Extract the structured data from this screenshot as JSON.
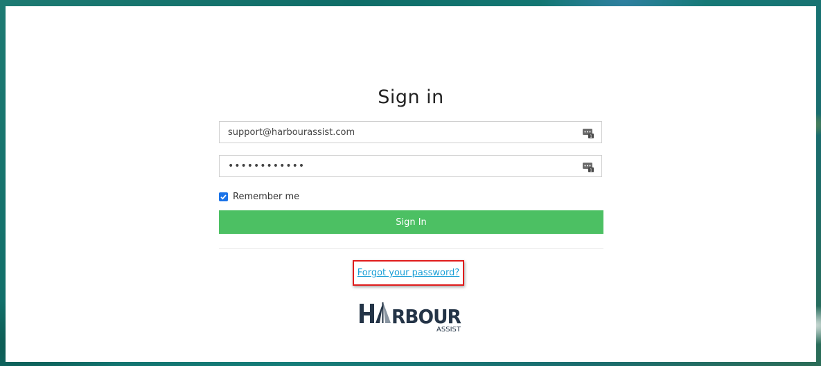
{
  "page": {
    "title": "Sign in"
  },
  "form": {
    "email_value": "support@harbourassist.com",
    "password_value": "••••••••••••",
    "remember_label": "Remember me",
    "remember_checked": true,
    "submit_label": "Sign In",
    "forgot_label": "Forgot your password?"
  },
  "brand": {
    "logo_text": "HARBOUR",
    "logo_subtext": "ASSIST"
  },
  "colors": {
    "accent_green": "#4cc063",
    "link_blue": "#1a9fd6",
    "highlight_red": "#e01b1b",
    "logo_navy": "#243447"
  },
  "icons": {
    "field_icon": "password-manager-icon",
    "checkbox": "checkmark-icon"
  }
}
